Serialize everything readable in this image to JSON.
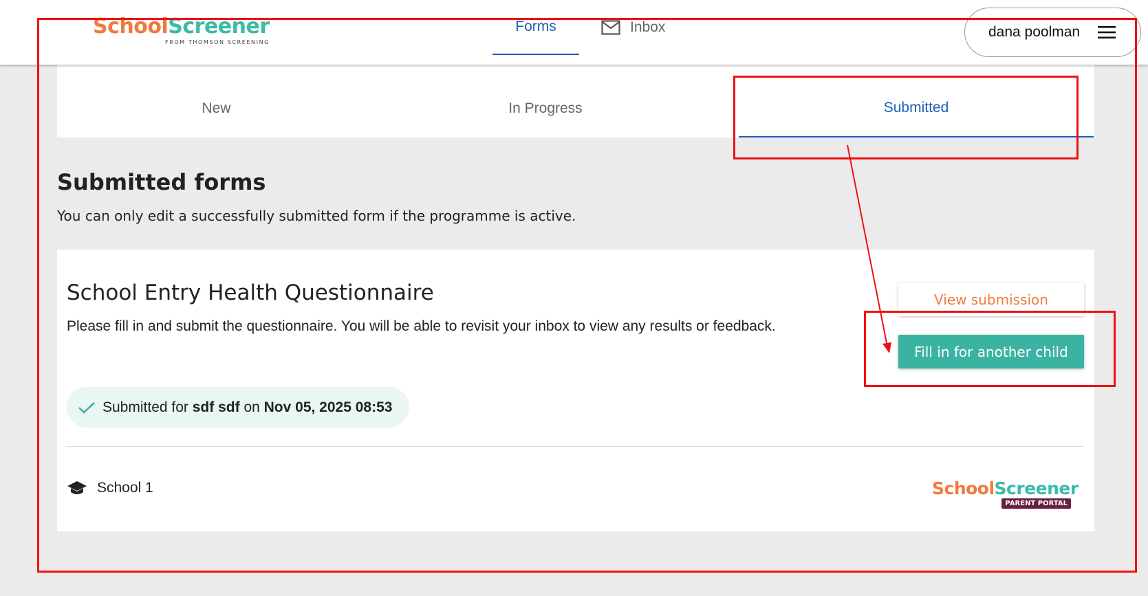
{
  "header": {
    "logo": {
      "part1": "School",
      "part2": "Screener",
      "sub": "FROM THOMSON SCREENING"
    },
    "nav": {
      "forms": "Forms",
      "inbox": "Inbox"
    },
    "user": {
      "name": "dana poolman"
    }
  },
  "tabs": {
    "new": "New",
    "in_progress": "In Progress",
    "submitted": "Submitted"
  },
  "page": {
    "title": "Submitted forms",
    "description": "You can only edit a successfully submitted form if the programme is active."
  },
  "form_card": {
    "title": "School Entry Health Questionnaire",
    "description": "Please fill in and submit the questionnaire. You will be able to revisit your inbox to view any results or feedback.",
    "view_button": "View submission",
    "fill_button": "Fill in for another child",
    "status": {
      "prefix": "Submitted for",
      "child": "sdf sdf",
      "on": "on",
      "datetime": "Nov 05, 2025 08:53"
    },
    "school": "School 1",
    "portal_logo": {
      "part1": "School",
      "part2": "Screener",
      "badge": "PARENT PORTAL"
    }
  },
  "colors": {
    "accent_blue": "#1a5fb4",
    "brand_orange": "#f07a3c",
    "brand_teal": "#3bbba9",
    "annotation_red": "#ee1111"
  }
}
